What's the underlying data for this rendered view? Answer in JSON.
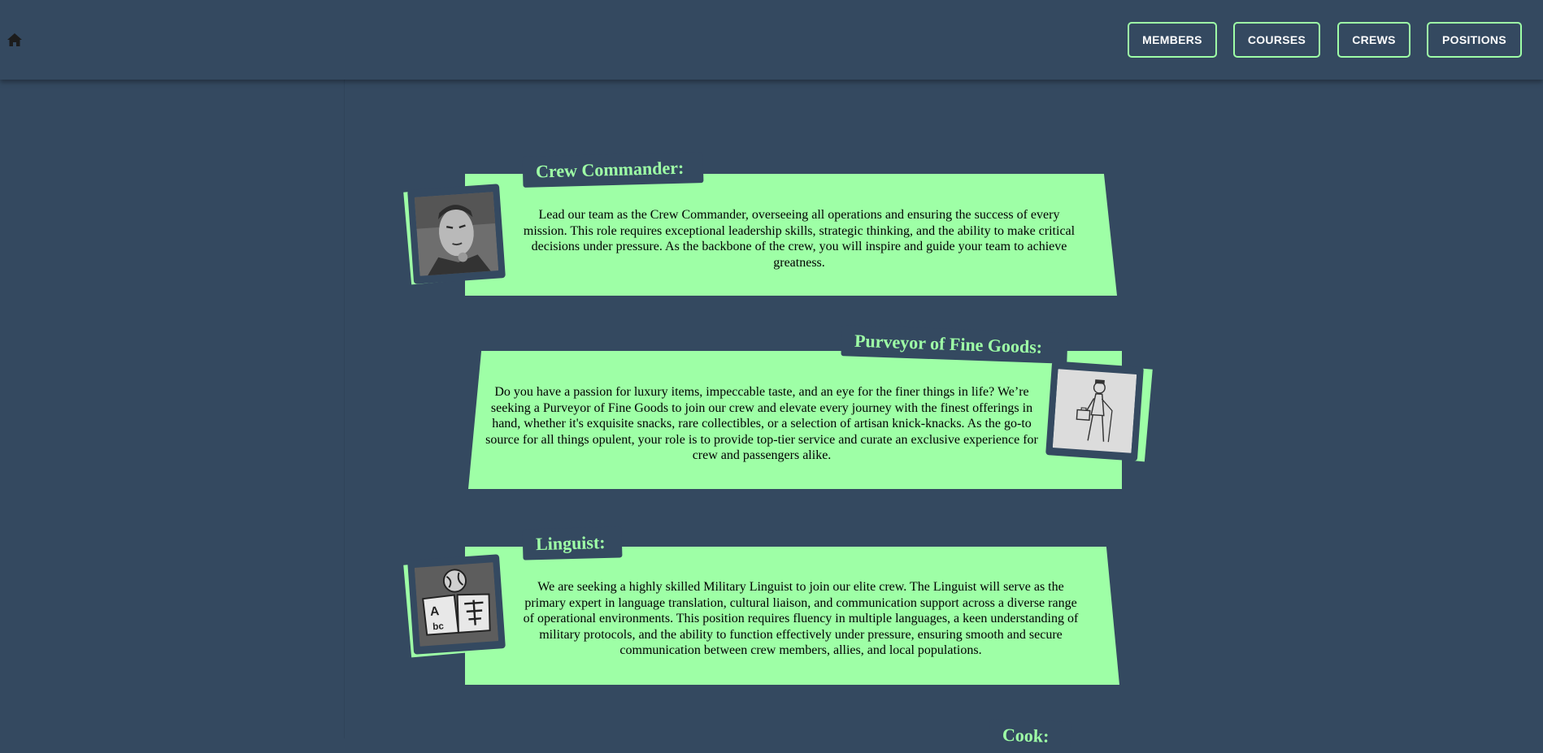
{
  "nav": {
    "home_icon": "home-icon",
    "buttons": [
      "MEMBERS",
      "COURSES",
      "CREWS",
      "POSITIONS"
    ]
  },
  "colors": {
    "background": "#344960",
    "accent": "#9effa6",
    "text": "#000000"
  },
  "positions": [
    {
      "title": "Crew Commander:",
      "description": "Lead our team as the Crew Commander, overseeing all operations and ensuring the success of every mission. This role requires exceptional leadership skills, strategic thinking, and the ability to make critical decisions under pressure. As the backbone of the crew, you will inspire and guide your team to achieve greatness.",
      "icon": "commander-portrait-image"
    },
    {
      "title": "Purveyor of Fine Goods:",
      "description": "Do you have a passion for luxury items, impeccable taste, and an eye for the finer things in life? We’re seeking a Purveyor of Fine Goods to join our crew and elevate every journey with the finest offerings in hand, whether it's exquisite snacks, rare collectibles, or a selection of artisan knick-knacks. As the go-to source for all things opulent, your role is to provide top-tier service and curate an exclusive experience for crew and passengers alike.",
      "icon": "gentleman-with-briefcase-image"
    },
    {
      "title": "Linguist:",
      "description": "We are seeking a highly skilled Military Linguist to join our elite crew. The Linguist will serve as the primary expert in language translation, cultural liaison, and communication support across a diverse range of operational environments. This position requires fluency in multiple languages, a keen understanding of military protocols, and the ability to function effectively under pressure, ensuring smooth and secure communication between crew members, allies, and local populations.",
      "icon": "language-book-globe-image"
    },
    {
      "title": "Cook:"
    }
  ]
}
